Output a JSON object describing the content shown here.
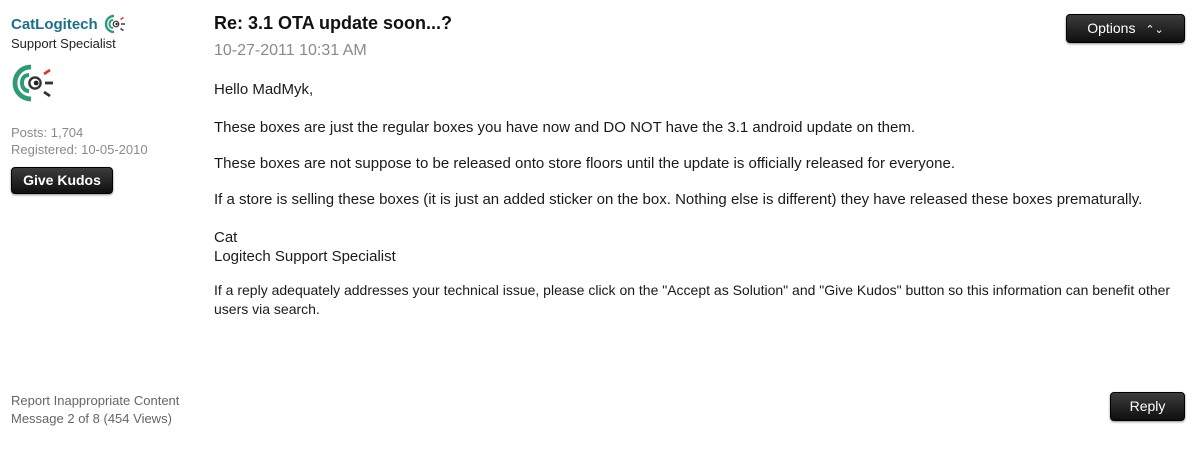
{
  "author": {
    "username": "CatLogitech",
    "rank": "Support Specialist",
    "posts": "Posts: 1,704",
    "registered": "Registered: 10-05-2010",
    "kudos_label": "Give Kudos",
    "rank_icon": "logitech-logo-icon",
    "avatar_icon": "logitech-logo-icon"
  },
  "post": {
    "subject": "Re: 3.1 OTA update soon...?",
    "date": "10-27-2011 10:31 AM",
    "options_label": "Options",
    "options_icon": "up-down-chevron-icon",
    "paragraphs": [
      "Hello MadMyk,",
      "These boxes are just the regular boxes you have now and DO NOT have the 3.1 android update on them.",
      "These boxes are not suppose to be released onto store floors until the update is officially released for everyone.",
      "If a store is selling these boxes (it is just an added sticker on the box. Nothing else is different) they have released these boxes prematurally."
    ],
    "signature": {
      "name": "Cat",
      "title": "Logitech Support Specialist",
      "note": "If a reply adequately addresses your technical issue, please click on the \"Accept as Solution\" and \"Give Kudos\" button so this information can benefit other users via search."
    }
  },
  "footer": {
    "report_label": "Report Inappropriate Content",
    "message_info": "Message 2 of 8 (454 Views)",
    "reply_label": "Reply"
  },
  "colors": {
    "username": "#1e6f86",
    "meta_gray": "#8a8a8a",
    "button_dark": "#1a1a1a",
    "logo_green": "#2f9a77",
    "logo_red": "#d33a2c"
  }
}
